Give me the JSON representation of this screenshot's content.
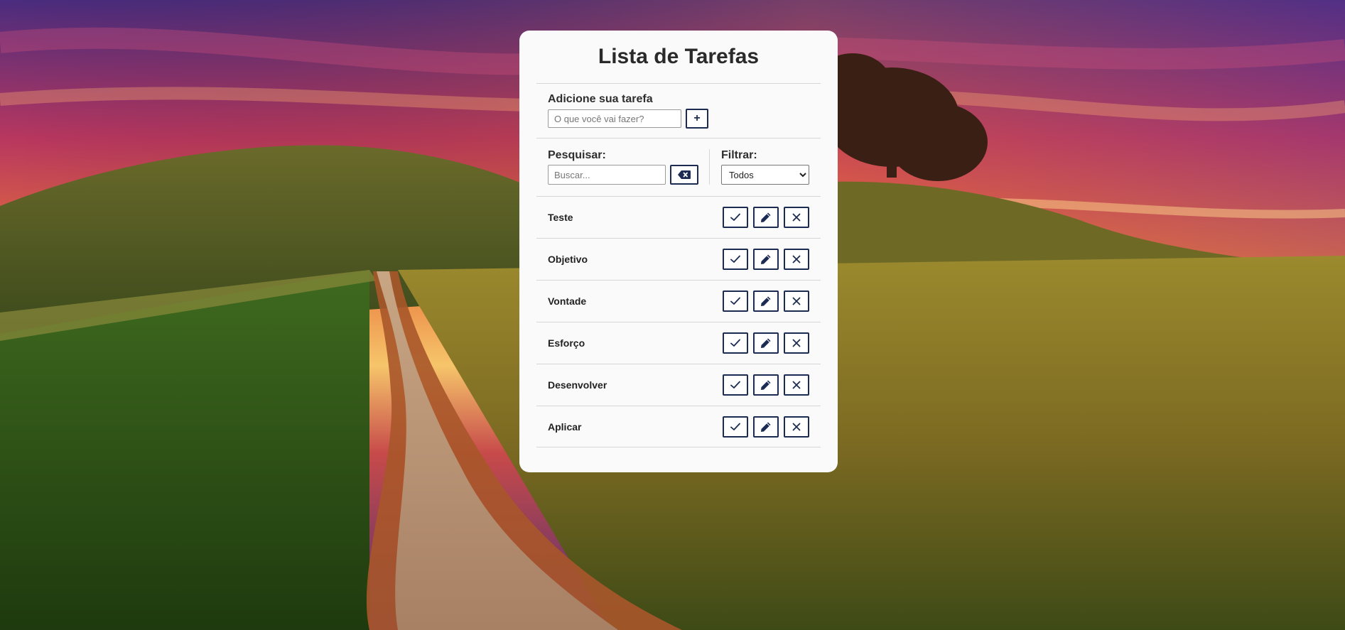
{
  "app": {
    "title": "Lista de Tarefas"
  },
  "add_task": {
    "label": "Adicione sua tarefa",
    "placeholder": "O que você vai fazer?",
    "value": "",
    "add_button_label": "+"
  },
  "search": {
    "label": "Pesquisar:",
    "placeholder": "Buscar...",
    "value": "",
    "clear_icon": "backspace-icon"
  },
  "filter": {
    "label": "Filtrar:",
    "selected": "Todos"
  },
  "tasks": [
    {
      "name": "Teste"
    },
    {
      "name": "Objetivo"
    },
    {
      "name": "Vontade"
    },
    {
      "name": "Esforço"
    },
    {
      "name": "Desenvolver"
    },
    {
      "name": "Aplicar"
    }
  ],
  "task_actions": [
    "check-icon",
    "pencil-icon",
    "close-icon"
  ],
  "colors": {
    "accent": "#1b2b52",
    "card_bg": "#fafafa"
  }
}
